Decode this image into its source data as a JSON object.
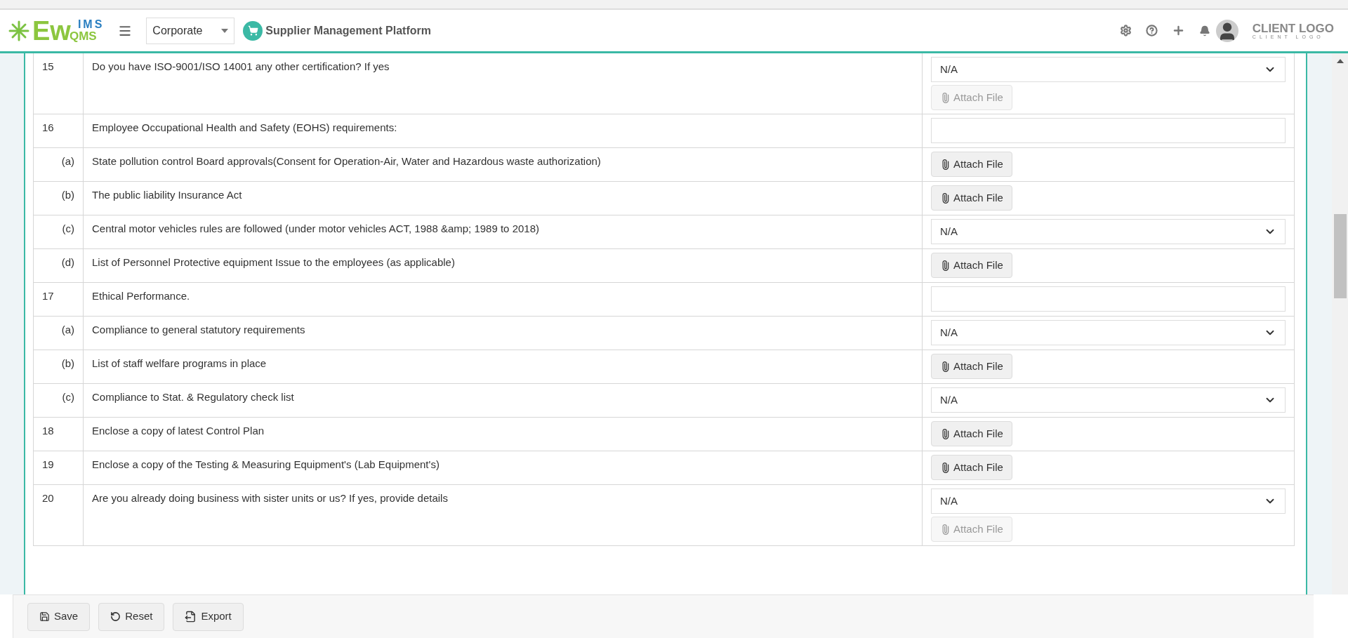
{
  "header": {
    "logo": {
      "main": "Ew",
      "top": "IMS",
      "bottom": "QMS"
    },
    "unit_select": "Corporate",
    "module": "Supplier Management Platform",
    "client_logo": {
      "main": "CLIENT LOGO",
      "sub": "CLIENT LOGO"
    }
  },
  "rows": [
    {
      "number": "15",
      "question": "Do you have ISO-9001/ISO 14001 any other certification? If yes",
      "answer": {
        "kind": "select",
        "value": "N/A",
        "attach": {
          "label": "Attach File",
          "disabled": true
        }
      }
    },
    {
      "number": "16",
      "question": "Employee Occupational Health and Safety (EOHS)  requirements:",
      "answer": {
        "kind": "text"
      },
      "children": [
        {
          "number": "(a)",
          "question": "State pollution control Board approvals(Consent for Operation-Air, Water and Hazardous waste authorization)",
          "answer": {
            "kind": "attach",
            "label": "Attach File",
            "disabled": false
          }
        },
        {
          "number": "(b)",
          "question": "The public liability Insurance Act",
          "answer": {
            "kind": "attach",
            "label": "Attach File",
            "disabled": false
          }
        },
        {
          "number": "(c)",
          "question": "Central motor vehicles rules are followed (under motor vehicles ACT, 1988 &amp; 1989 to 2018)",
          "answer": {
            "kind": "select",
            "value": "N/A"
          }
        },
        {
          "number": "(d)",
          "question": "List of Personnel Protective equipment Issue to the employees (as applicable)",
          "answer": {
            "kind": "attach",
            "label": "Attach File",
            "disabled": false
          }
        }
      ]
    },
    {
      "number": "17",
      "question": "Ethical Performance.",
      "answer": {
        "kind": "text"
      },
      "children": [
        {
          "number": "(a)",
          "question": "Compliance to general statutory requirements",
          "answer": {
            "kind": "select",
            "value": "N/A"
          }
        },
        {
          "number": "(b)",
          "question": "List of staff welfare programs in place",
          "answer": {
            "kind": "attach",
            "label": "Attach File",
            "disabled": false
          }
        },
        {
          "number": "(c)",
          "question": "Compliance to Stat. & Regulatory check list",
          "answer": {
            "kind": "select",
            "value": "N/A"
          }
        }
      ]
    },
    {
      "number": "18",
      "question": "Enclose a copy of latest Control Plan",
      "answer": {
        "kind": "attach",
        "label": "Attach File",
        "disabled": false
      }
    },
    {
      "number": "19",
      "question": "Enclose a copy of the Testing & Measuring Equipment's (Lab Equipment's)",
      "answer": {
        "kind": "attach",
        "label": "Attach File",
        "disabled": false
      }
    },
    {
      "number": "20",
      "question": "Are you already doing business with sister units or us? If yes, provide details",
      "answer": {
        "kind": "select",
        "value": "N/A",
        "attach": {
          "label": "Attach File",
          "disabled": true
        }
      }
    }
  ],
  "footer_buttons": [
    {
      "kind": "save",
      "label": "Save"
    },
    {
      "kind": "reset",
      "label": "Reset"
    },
    {
      "kind": "export",
      "label": "Export"
    }
  ]
}
